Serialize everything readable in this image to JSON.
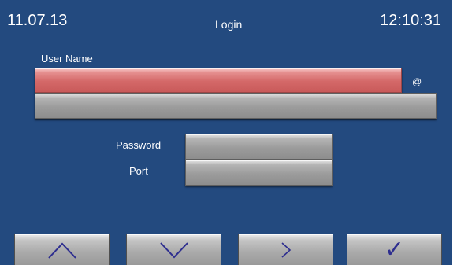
{
  "header": {
    "date": "11.07.13",
    "title": "Login",
    "time": "12:10:31"
  },
  "form": {
    "user_name_label": "User Name",
    "at_symbol": "@",
    "password_label": "Password",
    "port_label": "Port",
    "active_field": "user-name"
  },
  "navigation": {
    "buttons": [
      {
        "name": "up",
        "icon": "chevron-up-icon"
      },
      {
        "name": "down",
        "icon": "chevron-down-icon"
      },
      {
        "name": "next",
        "icon": "chevron-right-icon"
      },
      {
        "name": "confirm",
        "icon": "checkmark-icon",
        "glyph": "✓"
      }
    ]
  },
  "colors": {
    "background": "#234a7f",
    "active_field": "#d46868",
    "field": "#a9a9a9",
    "icon": "#2e2e8f"
  }
}
